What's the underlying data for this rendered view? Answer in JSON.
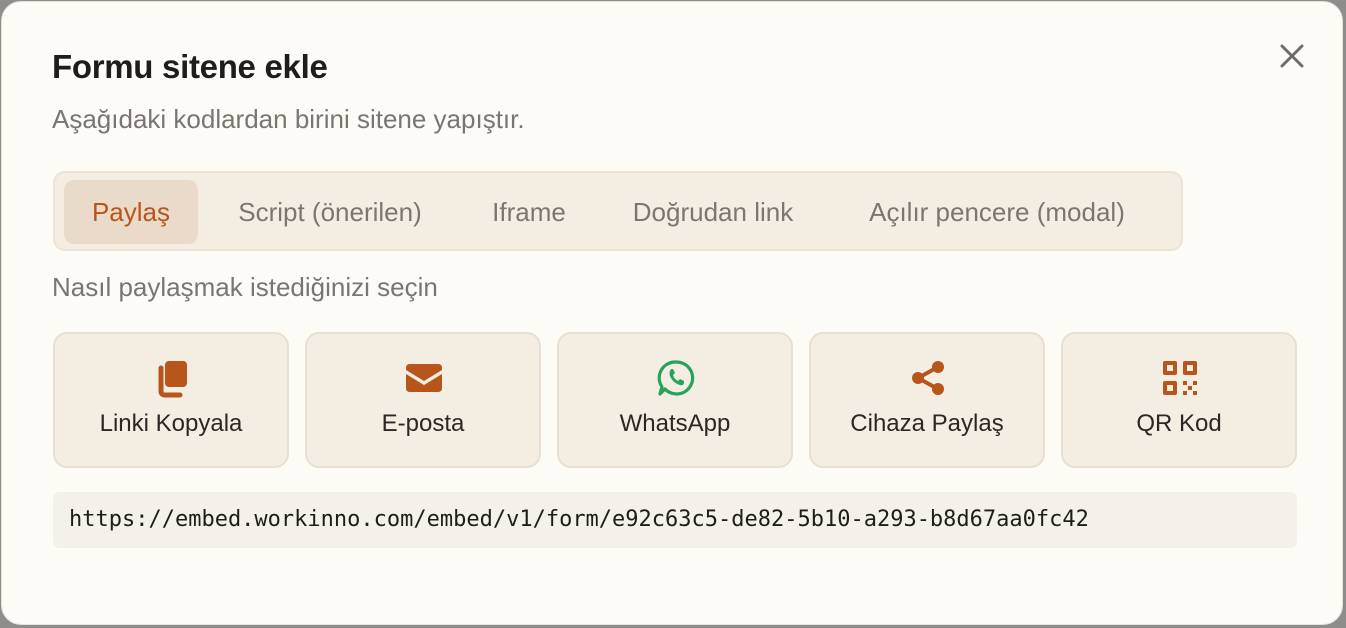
{
  "dialog": {
    "title": "Formu sitene ekle",
    "subtitle": "Aşağıdaki kodlardan birini sitene yapıştır.",
    "close_icon": "close-icon"
  },
  "tabs": [
    {
      "label": "Paylaş",
      "active": true
    },
    {
      "label": "Script (önerilen)",
      "active": false
    },
    {
      "label": "Iframe",
      "active": false
    },
    {
      "label": "Doğrudan link",
      "active": false
    },
    {
      "label": "Açılır pencere (modal)",
      "active": false
    }
  ],
  "share": {
    "label": "Nasıl paylaşmak istediğinizi seçin",
    "options": [
      {
        "label": "Linki Kopyala",
        "icon": "copy-icon"
      },
      {
        "label": "E-posta",
        "icon": "envelope-icon"
      },
      {
        "label": "WhatsApp",
        "icon": "whatsapp-icon"
      },
      {
        "label": "Cihaza Paylaş",
        "icon": "share-icon"
      },
      {
        "label": "QR Kod",
        "icon": "qr-code-icon"
      }
    ],
    "url": "https://embed.workinno.com/embed/v1/form/e92c63c5-de82-5b10-a293-b8d67aa0fc42"
  },
  "colors": {
    "accent": "#b7551a",
    "whatsapp": "#25a35a",
    "background": "#fdfbf5",
    "tab_bg": "#f4ede2",
    "tab_active_bg": "#eadac9"
  }
}
